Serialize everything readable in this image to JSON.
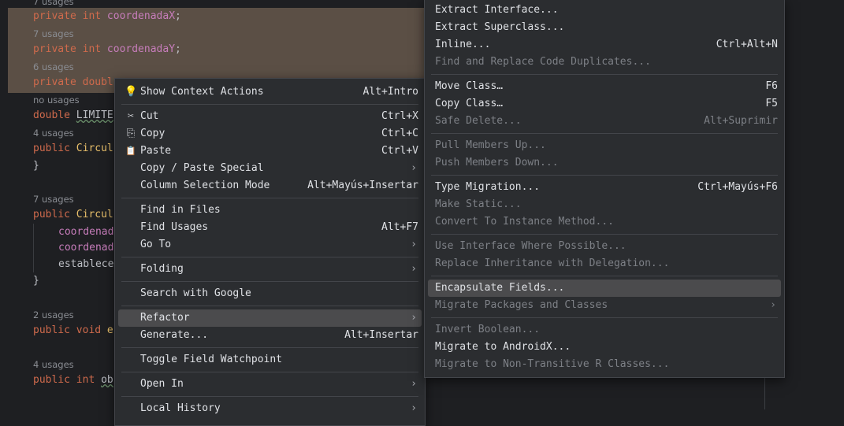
{
  "editor": {
    "lines": [
      {
        "type": "hint",
        "text": "7 usages"
      },
      {
        "type": "field",
        "kw": "private int ",
        "name": "coordenadaX",
        ";": ";"
      },
      {
        "type": "hint",
        "text": "7 usages"
      },
      {
        "type": "field",
        "kw": "private int ",
        "name": "coordenadaY",
        ";": ";"
      },
      {
        "type": "hint",
        "text": "6 usages"
      },
      {
        "type": "field",
        "kw": "private doubl",
        "name": "",
        ";": ""
      },
      {
        "type": "hint",
        "text": "no usages"
      },
      {
        "type": "code",
        "kw": "double ",
        "name": "LIMITE"
      },
      {
        "type": "hint",
        "text": "4 usages"
      },
      {
        "type": "code",
        "kw": "public ",
        "name": "Circul"
      },
      {
        "type": "brace",
        "text": "}"
      },
      {
        "type": "hint",
        "text": "7 usages"
      },
      {
        "type": "code",
        "kw": "public ",
        "name": "Circul"
      },
      {
        "type": "body",
        "text": "coordenad"
      },
      {
        "type": "body",
        "text": "coordenad"
      },
      {
        "type": "body",
        "text": "establece"
      },
      {
        "type": "brace",
        "text": "}"
      },
      {
        "type": "hint",
        "text": "2 usages"
      },
      {
        "type": "code",
        "kw": "public void ",
        "name": "e"
      },
      {
        "type": "hint",
        "text": "4 usages"
      },
      {
        "type": "code",
        "kw": "public int ",
        "name": "ob"
      }
    ]
  },
  "context_menu": {
    "items": [
      {
        "label": "Show Context Actions",
        "shortcut": "Alt+Intro",
        "icon": "💡"
      },
      {
        "label": "Cut",
        "shortcut": "Ctrl+X",
        "icon": "✂"
      },
      {
        "label": "Copy",
        "shortcut": "Ctrl+C",
        "icon": "⎘"
      },
      {
        "label": "Paste",
        "shortcut": "Ctrl+V",
        "icon": "📋"
      },
      {
        "label": "Copy / Paste Special",
        "arrow": "›"
      },
      {
        "label": "Column Selection Mode",
        "shortcut": "Alt+Mayús+Insertar"
      },
      {
        "label": "Find in Files"
      },
      {
        "label": "Find Usages",
        "shortcut": "Alt+F7"
      },
      {
        "label": "Go To",
        "arrow": "›"
      },
      {
        "label": "Folding",
        "arrow": "›"
      },
      {
        "label": "Search with Google"
      },
      {
        "label": "Refactor",
        "arrow": "›"
      },
      {
        "label": "Generate...",
        "shortcut": "Alt+Insertar"
      },
      {
        "label": "Toggle Field Watchpoint"
      },
      {
        "label": "Open In",
        "arrow": "›"
      },
      {
        "label": "Local History",
        "arrow": "›"
      }
    ]
  },
  "refactor_menu": {
    "items": [
      {
        "label": "Extract Interface..."
      },
      {
        "label": "Extract Superclass..."
      },
      {
        "label": "Inline...",
        "shortcut": "Ctrl+Alt+N"
      },
      {
        "label": "Find and Replace Code Duplicates..."
      },
      {
        "label": "Move Class…",
        "shortcut": "F6"
      },
      {
        "label": "Copy Class…",
        "shortcut": "F5"
      },
      {
        "label": "Safe Delete...",
        "shortcut": "Alt+Suprimir"
      },
      {
        "label": "Pull Members Up..."
      },
      {
        "label": "Push Members Down..."
      },
      {
        "label": "Type Migration...",
        "shortcut": "Ctrl+Mayús+F6"
      },
      {
        "label": "Make Static..."
      },
      {
        "label": "Convert To Instance Method..."
      },
      {
        "label": "Use Interface Where Possible..."
      },
      {
        "label": "Replace Inheritance with Delegation..."
      },
      {
        "label": "Encapsulate Fields..."
      },
      {
        "label": "Migrate Packages and Classes",
        "arrow": "›"
      },
      {
        "label": "Invert Boolean..."
      },
      {
        "label": "Migrate to AndroidX..."
      },
      {
        "label": "Migrate to Non-Transitive R Classes..."
      }
    ]
  },
  "colors": {
    "selection_band": "#5b4f45",
    "menu_bg": "#2b2d30",
    "selected_item": "#4b4b4d"
  }
}
